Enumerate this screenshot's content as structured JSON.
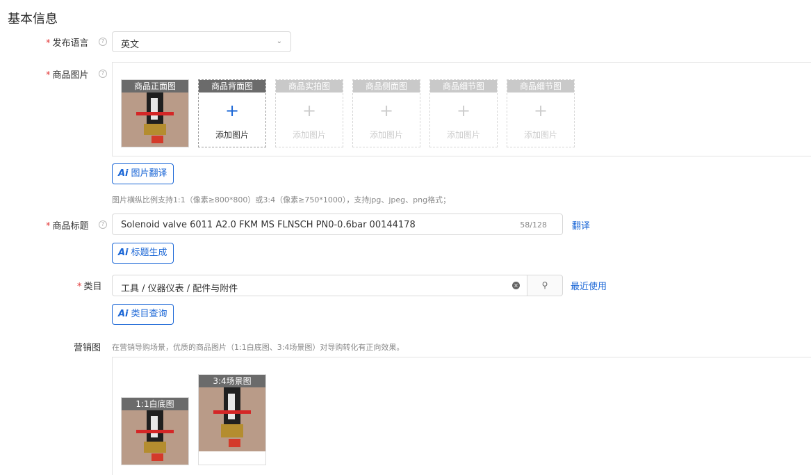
{
  "section_title": "基本信息",
  "fields": {
    "language": {
      "label": "发布语言",
      "value": "英文"
    },
    "images": {
      "label": "商品图片",
      "slots": [
        {
          "caption": "商品正面图",
          "filled": true
        },
        {
          "caption": "商品背面图",
          "add": "添加图片"
        },
        {
          "caption": "商品实拍图",
          "add": "添加图片"
        },
        {
          "caption": "商品侧面图",
          "add": "添加图片"
        },
        {
          "caption": "商品细节图",
          "add": "添加图片"
        },
        {
          "caption": "商品细节图",
          "add": "添加图片"
        }
      ],
      "ai_button": "图片翻译",
      "hint": "图片横纵比例支持1:1（像素≥800*800）或3:4（像素≥750*1000），支持jpg、jpeg、png格式；"
    },
    "title": {
      "label": "商品标题",
      "value": "Solenoid valve 6011 A2.0 FKM MS FLNSCH PN0-0.6bar 00144178",
      "count": "58/128",
      "translate": "翻译",
      "ai_button": "标题生成"
    },
    "category": {
      "label": "类目",
      "value": "工具 / 仪器仪表 / 配件与附件",
      "recent": "最近使用",
      "ai_button": "类目查询"
    },
    "marketing": {
      "label": "营销图",
      "hint": "在营销导购场景，优质的商品图片（1:1白底图、3:4场景图）对导购转化有正向效果。",
      "slots": [
        {
          "caption": "1:1白底图"
        },
        {
          "caption": "3:4场景图"
        }
      ]
    }
  },
  "icons": {
    "help": "question-circle-icon",
    "chevron": "chevron-down-icon",
    "plus": "plus-icon",
    "clear": "clear-icon",
    "search": "search-icon"
  },
  "colors": {
    "accent": "#1a66d6",
    "required": "#e23b3b"
  },
  "ai_glyph": "Ai",
  "required_mark": "*"
}
